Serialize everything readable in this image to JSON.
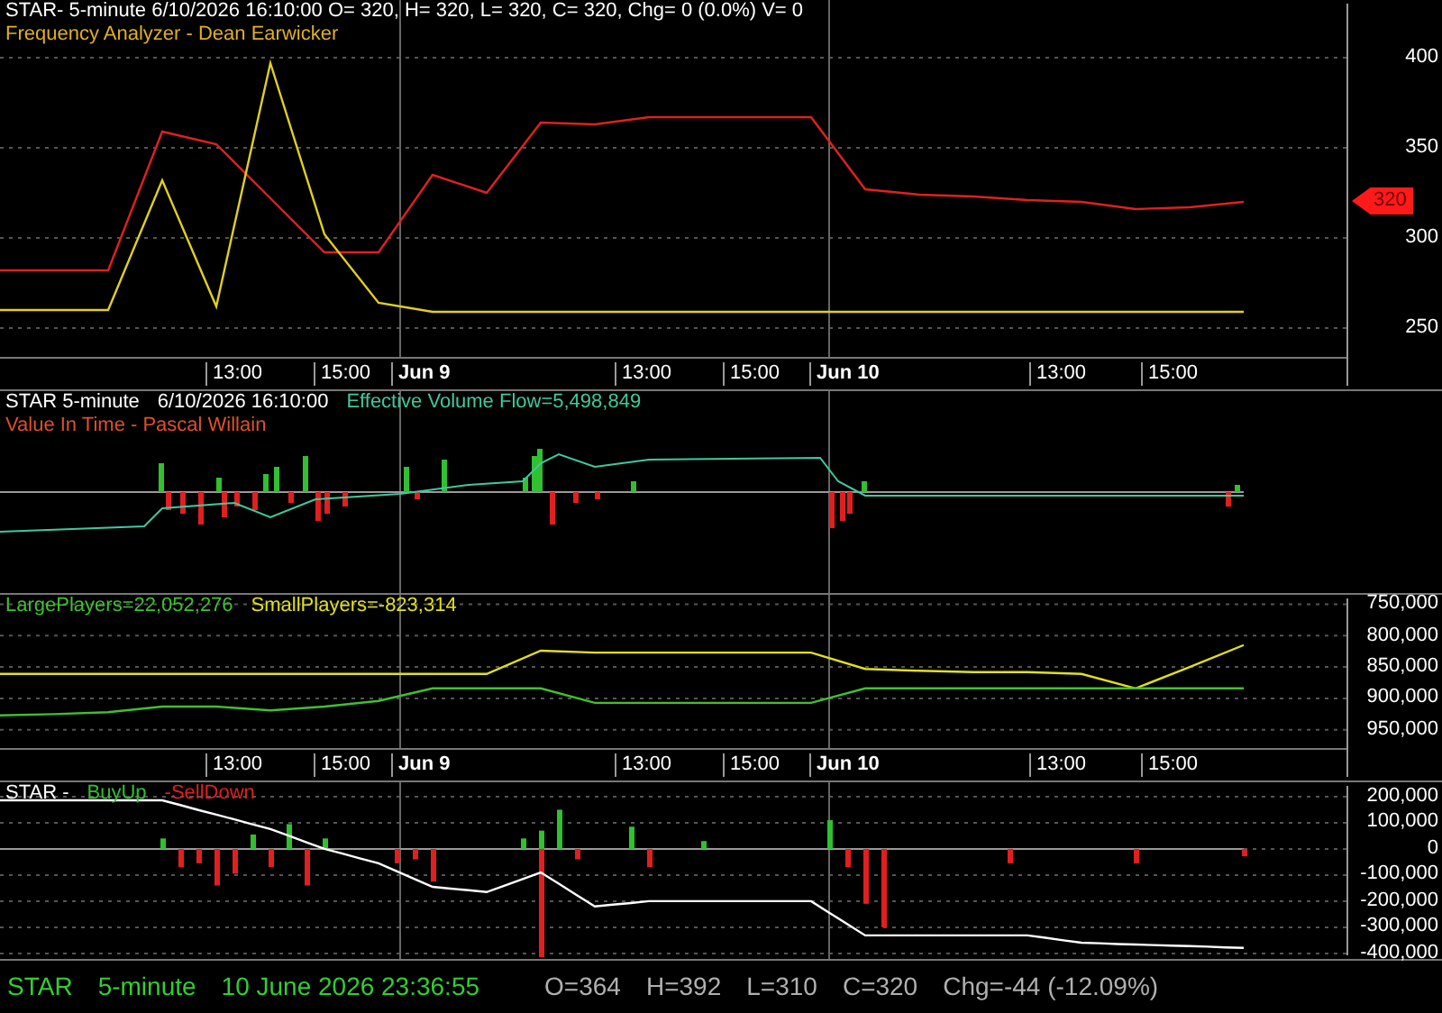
{
  "panes": [
    {
      "kind": "price",
      "legend": [
        [
          {
            "text": "STAR- 5-minute 6/10/2026 16:10:00 O= 320, H= 320, L= 320, C= 320, Chg= 0 (0.0%) V= 0",
            "color": "#ffffff"
          }
        ],
        [
          {
            "text": "Frequency Analyzer - Dean Earwicker",
            "color": "#e0b020"
          }
        ]
      ],
      "price_tag": "320",
      "chart_data": {
        "type": "line",
        "grid": true,
        "ylim": [
          234,
          432
        ],
        "yticks": [
          {
            "value": 400,
            "label": "400"
          },
          {
            "value": 350,
            "label": "350"
          },
          {
            "value": 300,
            "label": "300"
          },
          {
            "value": 250,
            "label": "250"
          }
        ],
        "series": [
          {
            "color": "#e02020",
            "values": [
              282,
              282,
              282,
              359,
              352,
              322,
              292,
              292,
              335,
              325,
              364,
              363,
              367,
              367,
              367,
              367,
              327,
              324,
              323,
              321,
              320,
              316,
              317,
              320
            ]
          },
          {
            "color": "#e0d020",
            "values": [
              260,
              260,
              260,
              332,
              262,
              397,
              302,
              264,
              259,
              259,
              259,
              259,
              259,
              259,
              259,
              259,
              259,
              259,
              259,
              259,
              259,
              259,
              259,
              259
            ]
          }
        ]
      },
      "time_axis": [
        {
          "label": "13:00",
          "kind": "time"
        },
        {
          "label": "15:00",
          "kind": "time"
        },
        {
          "label": "Jun 9",
          "kind": "day"
        },
        {
          "label": "13:00",
          "kind": "time"
        },
        {
          "label": "15:00",
          "kind": "time"
        },
        {
          "label": "Jun 10",
          "kind": "day"
        },
        {
          "label": "13:00",
          "kind": "time"
        },
        {
          "label": "15:00",
          "kind": "time"
        }
      ]
    },
    {
      "kind": "flow",
      "legend": [
        [
          {
            "text": "STAR 5-minute",
            "color": "#ffffff"
          },
          {
            "text": "6/10/2026 16:10:00",
            "color": "#ffffff"
          },
          {
            "text": "Effective Volume Flow=5,498,849",
            "color": "#40c8a0"
          }
        ],
        [
          {
            "text": "Value In Time - Pascal Willain",
            "color": "#e0502a"
          }
        ]
      ]
    },
    {
      "kind": "players",
      "legend": [
        [
          {
            "text": "LargePlayers=22,052,276",
            "color": "#40c030"
          },
          {
            "text": "SmallPlayers=-823,314",
            "color": "#e0e020"
          }
        ]
      ],
      "chart_data": {
        "type": "line",
        "grid": true,
        "ylim": [
          979000,
          735000
        ],
        "yticks": [
          {
            "value": 750000,
            "label": "750,000"
          },
          {
            "value": 800000,
            "label": "800,000"
          },
          {
            "value": 850000,
            "label": "850,000"
          },
          {
            "value": 900000,
            "label": "900,000"
          },
          {
            "value": 950000,
            "label": "950,000"
          }
        ],
        "series": [
          {
            "color": "#e0e020",
            "values": [
              861000,
              861000,
              861000,
              861000,
              861000,
              861000,
              861000,
              861000,
              861000,
              861000,
              824000,
              827000,
              827000,
              827000,
              827000,
              827000,
              853000,
              856000,
              858000,
              858000,
              861000,
              884000,
              850000,
              815000
            ]
          },
          {
            "color": "#40c030",
            "values": [
              927000,
              925000,
              922000,
              913000,
              913000,
              919000,
              913000,
              904000,
              884000,
              884000,
              884000,
              907000,
              907000,
              907000,
              907000,
              907000,
              884000,
              884000,
              884000,
              884000,
              884000,
              884000,
              884000,
              884000
            ]
          }
        ]
      },
      "time_axis": [
        {
          "label": "13:00",
          "kind": "time"
        },
        {
          "label": "15:00",
          "kind": "time"
        },
        {
          "label": "Jun 9",
          "kind": "day"
        },
        {
          "label": "13:00",
          "kind": "time"
        },
        {
          "label": "15:00",
          "kind": "time"
        },
        {
          "label": "Jun 10",
          "kind": "day"
        },
        {
          "label": "13:00",
          "kind": "time"
        },
        {
          "label": "15:00",
          "kind": "time"
        }
      ]
    },
    {
      "kind": "buyup",
      "legend": [
        [
          {
            "text": "STAR -",
            "color": "#ffffff"
          },
          {
            "text": "BuyUp",
            "color": "#30c030"
          },
          {
            "text": "-SellDown",
            "color": "#e02020"
          }
        ]
      ],
      "chart_data": {
        "type": "bar",
        "grid": true,
        "ylim": [
          -421000,
          255000
        ],
        "yticks": [
          {
            "value": 200000,
            "label": "200,000"
          },
          {
            "value": 100000,
            "label": "100,000"
          },
          {
            "value": 0,
            "label": "0"
          },
          {
            "value": -100000,
            "label": "-100,000"
          },
          {
            "value": -200000,
            "label": "-200,000"
          },
          {
            "value": -300000,
            "label": "-300,000"
          },
          {
            "value": -400000,
            "label": "-400,000"
          }
        ],
        "series": [
          {
            "color": "#30c030",
            "values": [
              null,
              null,
              null,
              null,
              null,
              null,
              null,
              null,
              null,
              40000,
              null,
              null,
              null,
              null,
              55000,
              null,
              95000,
              null,
              40000,
              null,
              null,
              null,
              null,
              null,
              null,
              null,
              null,
              null,
              null,
              40000,
              70000,
              150000,
              null,
              null,
              null,
              85000,
              null,
              null,
              null,
              30000,
              null,
              null,
              null,
              null,
              null,
              null,
              110000,
              null,
              null,
              null,
              null,
              null,
              null,
              null,
              null,
              null,
              null,
              null,
              null,
              null,
              null,
              null,
              null,
              null,
              null,
              null,
              null,
              null,
              null,
              null
            ]
          },
          {
            "color": "#e02020",
            "values": [
              null,
              null,
              null,
              null,
              null,
              null,
              null,
              null,
              null,
              null,
              -70000,
              -55000,
              -140000,
              -95000,
              null,
              -70000,
              null,
              -140000,
              null,
              null,
              null,
              null,
              -55000,
              -40000,
              -125000,
              null,
              null,
              null,
              null,
              null,
              -414000,
              null,
              -40000,
              null,
              null,
              null,
              -70000,
              null,
              null,
              null,
              null,
              null,
              null,
              null,
              null,
              null,
              null,
              -70000,
              -210000,
              -300000,
              null,
              null,
              null,
              null,
              null,
              null,
              -55000,
              null,
              null,
              null,
              null,
              null,
              null,
              -55000,
              null,
              null,
              null,
              null,
              null,
              -28000
            ]
          },
          {
            "type": "line",
            "color": "#ffffff",
            "values": [
              186000,
              186000,
              186000,
              186000,
              186000,
              186000,
              186000,
              186000,
              186000,
              186000,
              168000,
              149000,
              131000,
              113000,
              94000,
              76000,
              51000,
              25000,
              0,
              -18000,
              -37000,
              -55000,
              -85000,
              -115000,
              -145000,
              -152000,
              -158000,
              -165000,
              -140000,
              -115000,
              -90000,
              -133000,
              -177000,
              -220000,
              -213000,
              -207000,
              -200000,
              -200000,
              -200000,
              -200000,
              -200000,
              -200000,
              -200000,
              -200000,
              -200000,
              -200000,
              -244000,
              -287000,
              -331000,
              -331000,
              -331000,
              -331000,
              -331000,
              -331000,
              -331000,
              -331000,
              -331000,
              -331000,
              -340000,
              -350000,
              -359000,
              -361000,
              -364000,
              -366000,
              -368000,
              -370000,
              -372000,
              -374000,
              -377000,
              -379000
            ]
          }
        ]
      }
    }
  ],
  "status_bar": {
    "symbol": "STAR",
    "interval": "5-minute",
    "datetime": "10 June 2026 23:36:55",
    "quotes": [
      "O=364",
      "H=392",
      "L=310",
      "C=320",
      "Chg=-44 (-12.09%)"
    ]
  }
}
